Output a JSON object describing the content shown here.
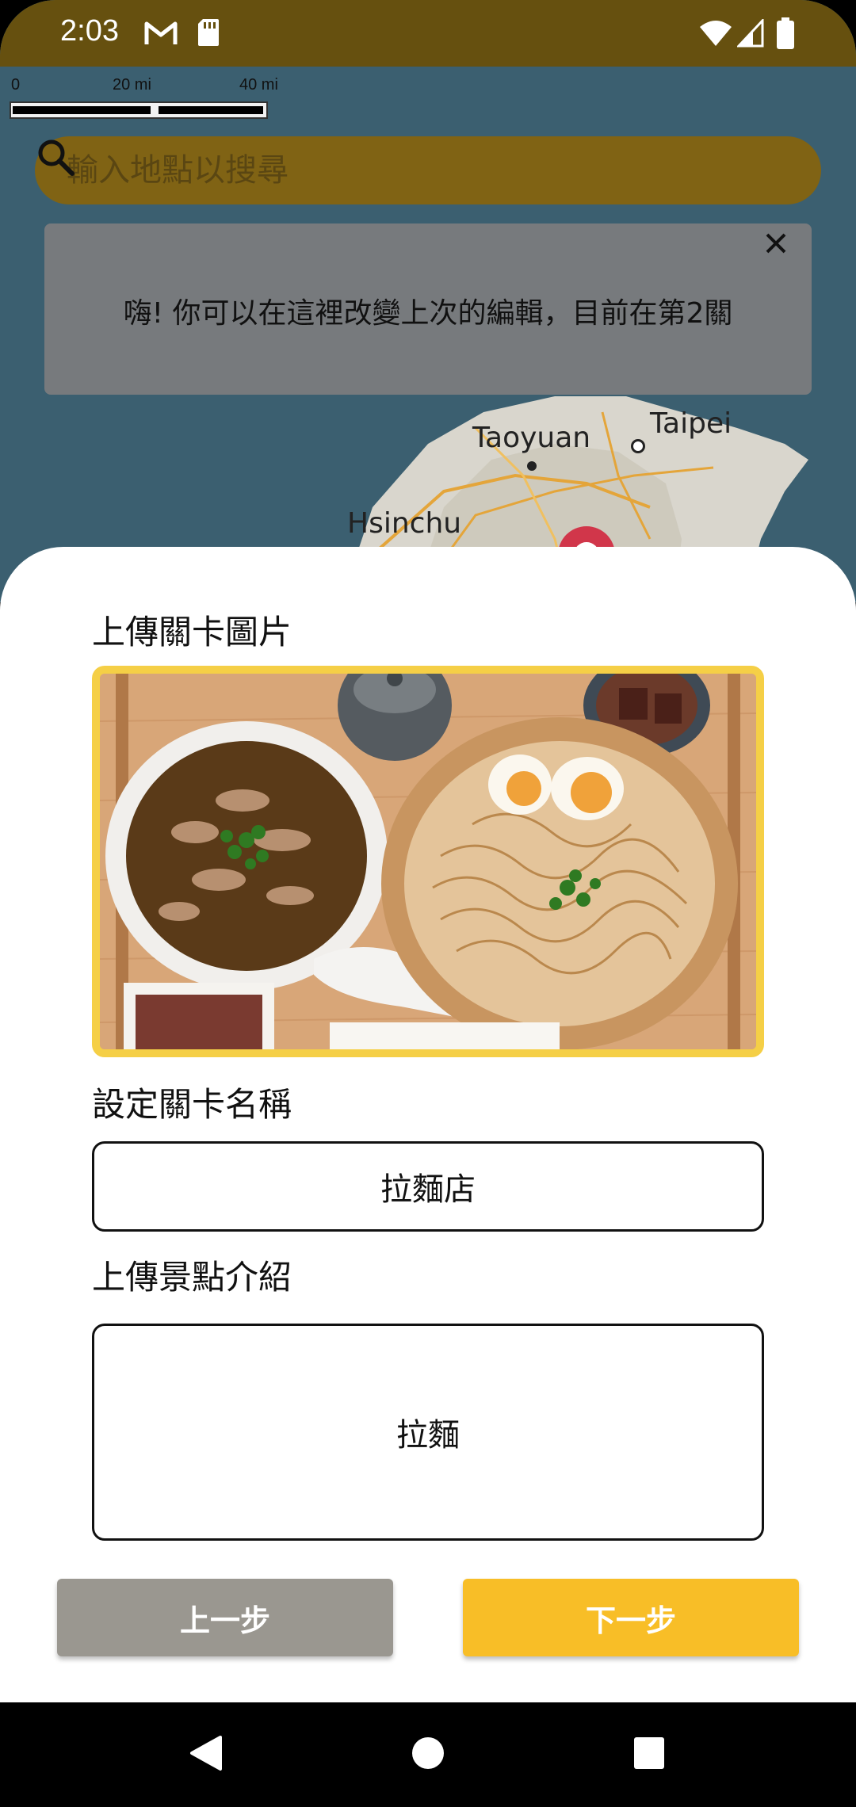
{
  "status_bar": {
    "time": "2:03",
    "icons": [
      "gmail-icon",
      "sd-card-icon",
      "wifi-icon",
      "cell-signal-icon",
      "battery-icon"
    ]
  },
  "map": {
    "scale": {
      "labels": [
        "0",
        "20 mi",
        "40 mi"
      ]
    },
    "labels": [
      "Taoyuan",
      "Taipei",
      "Hsinchu"
    ],
    "search": {
      "placeholder": "輸入地點以搜尋"
    },
    "toast": {
      "message": "嗨! 你可以在這裡改變上次的編輯，目前在第2關"
    }
  },
  "form": {
    "image_label": "上傳關卡圖片",
    "name_label": "設定關卡名稱",
    "name_value": "拉麵店",
    "intro_label": "上傳景點介紹",
    "intro_value": "拉麵"
  },
  "buttons": {
    "prev": "上一步",
    "next": "下一步"
  },
  "colors": {
    "status_bar": "#66500f",
    "search_bg": "#806314",
    "photo_border": "#f5cf46",
    "next_button": "#f8be27",
    "prev_button": "#9a9790"
  }
}
